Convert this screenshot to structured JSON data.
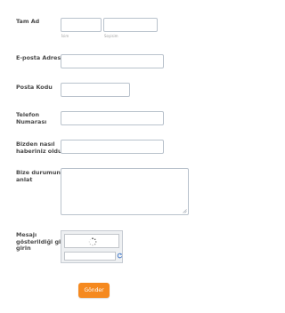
{
  "form": {
    "name": {
      "label": "Tam Ad",
      "first_value": "",
      "first_sublabel": "İsim",
      "last_value": "",
      "last_sublabel": "Soyisim"
    },
    "email": {
      "label": "E-posta Adresi",
      "value": ""
    },
    "postal": {
      "label": "Posta Kodu",
      "value": ""
    },
    "phone": {
      "label_line1": "Telefon",
      "label_line2": "Numarası",
      "value": ""
    },
    "referral": {
      "label_line1": "Bizden nasıl",
      "label_line2": "haberiniz oldu?",
      "value": ""
    },
    "message": {
      "label_line1": "Bize durumunu",
      "label_line2": "anlat",
      "value": ""
    },
    "captcha": {
      "label_line1": "Mesajı",
      "label_line2": "gösterildiği gibi",
      "label_line3": "girin",
      "value": ""
    },
    "submit_label": "Gönder"
  },
  "colors": {
    "accent": "#f5891f",
    "border": "#b9c2cc",
    "label": "#4a4a4a",
    "refresh_icon": "#3a73c8"
  },
  "icons": [
    "loading-spinner-icon",
    "refresh-icon",
    "resize-grip-icon"
  ]
}
